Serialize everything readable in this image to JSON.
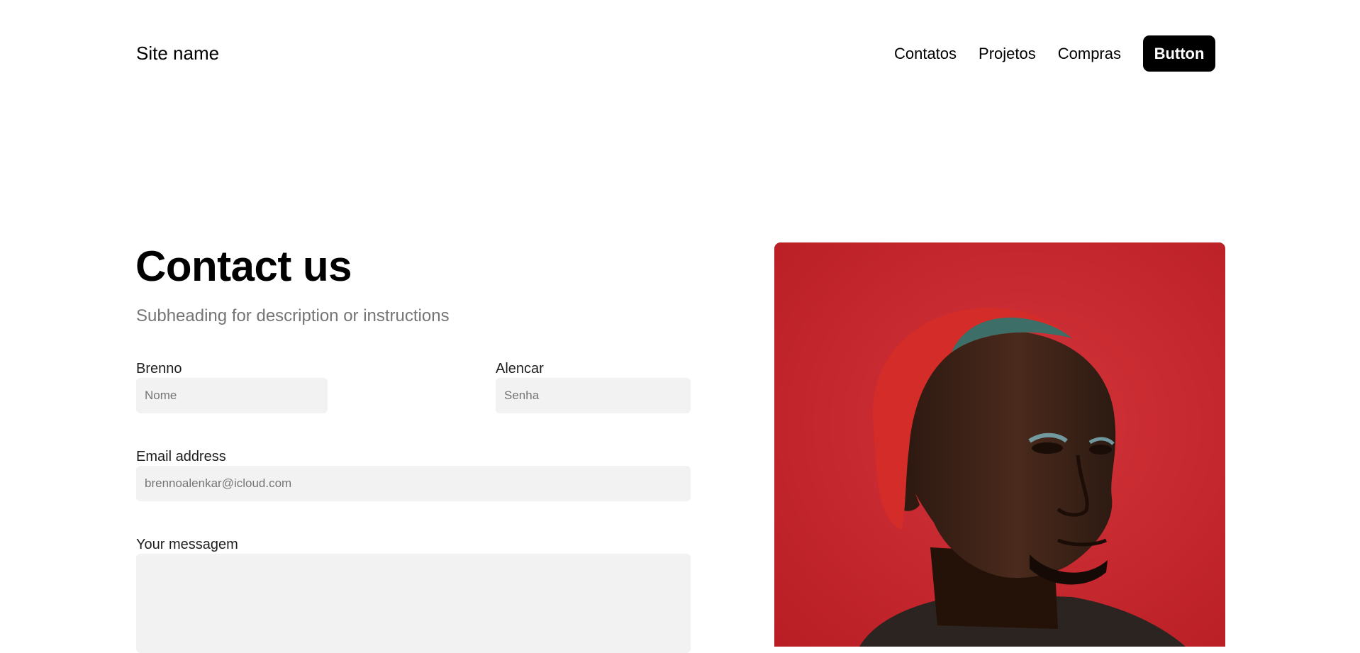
{
  "header": {
    "site_name": "Site name",
    "nav": [
      "Contatos",
      "Projetos",
      "Compras"
    ],
    "button_label": "Button"
  },
  "contact": {
    "title": "Contact us",
    "subtitle": "Subheading for description or instructions",
    "first_name": {
      "label": "Brenno",
      "placeholder": "Nome"
    },
    "last_name": {
      "label": "Alencar",
      "placeholder": "Senha"
    },
    "email": {
      "label": "Email address",
      "placeholder": "brennoalenkar@icloud.com"
    },
    "message": {
      "label": "Your messagem",
      "placeholder": ""
    }
  },
  "photo": {
    "subject": "portrait-photo",
    "background_color": "#c62129"
  }
}
